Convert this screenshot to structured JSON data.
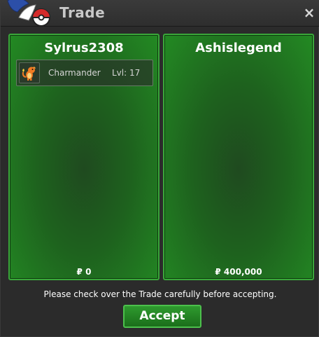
{
  "window": {
    "title": "Trade",
    "close_glyph": "×",
    "logo_icon": "pokeball-logo-icon"
  },
  "left_panel": {
    "player": "Sylrus2308",
    "items": [
      {
        "icon": "charmander-icon",
        "name": "Charmander",
        "level": "Lvl: 17"
      }
    ],
    "money": "₽ 0"
  },
  "right_panel": {
    "player": "Ashislegend",
    "items": [],
    "money": "₽ 400,000"
  },
  "notice": "Please check over the Trade carefully before accepting.",
  "accept_label": "Accept",
  "colors": {
    "panel_border": "#3aa83a",
    "panel_fill": "#1e621e",
    "button": "#2e9a2e"
  }
}
